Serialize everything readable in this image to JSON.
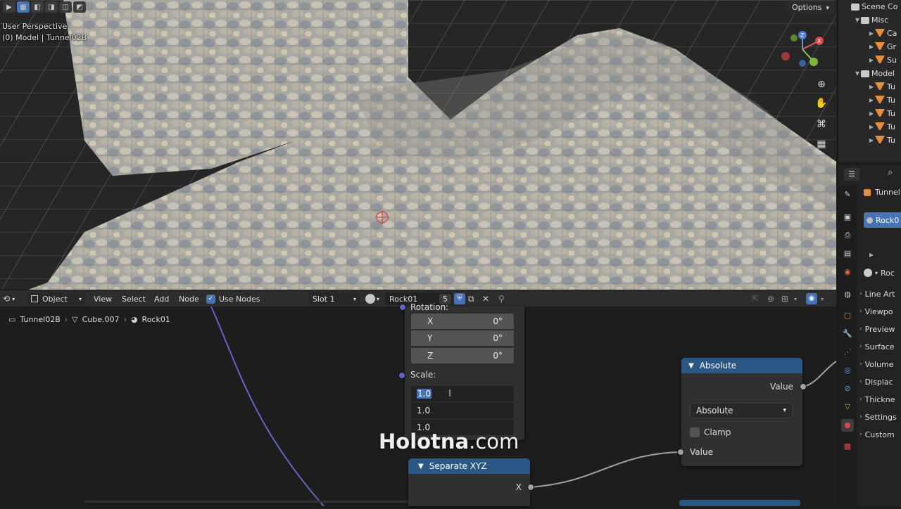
{
  "viewport": {
    "perspective_label": "User Perspective",
    "object_label": "(0) Model | Tunnel02B",
    "options_label": "Options"
  },
  "outliner": {
    "title": "Scene Co",
    "items": [
      {
        "label": "Misc",
        "type": "collection"
      },
      {
        "label": "Ca",
        "type": "object"
      },
      {
        "label": "Gr",
        "type": "object"
      },
      {
        "label": "Su",
        "type": "object"
      },
      {
        "label": "Model",
        "type": "collection"
      },
      {
        "label": "Tu",
        "type": "object"
      },
      {
        "label": "Tu",
        "type": "object"
      },
      {
        "label": "Tu",
        "type": "object"
      },
      {
        "label": "Tu",
        "type": "object"
      },
      {
        "label": "Tu",
        "type": "object"
      }
    ]
  },
  "properties": {
    "object_name": "Tunnel",
    "material_name": "Rock0",
    "material_slot": "Roc",
    "sections": [
      "Line Art",
      "Viewpo",
      "Preview",
      "Surface",
      "Volume",
      "Displac",
      "Thickne",
      "Settings",
      "Custom"
    ]
  },
  "node_header": {
    "editor_type": "Object",
    "menu": [
      "View",
      "Select",
      "Add",
      "Node"
    ],
    "use_nodes_label": "Use Nodes",
    "slot_label": "Slot 1",
    "material_name": "Rock01",
    "user_count": "5"
  },
  "breadcrumb": [
    "Tunnel02B",
    "Cube.007",
    "Rock01"
  ],
  "mapping_panel": {
    "rotation_label": "Rotation:",
    "rotation": [
      {
        "axis": "X",
        "value": "0°"
      },
      {
        "axis": "Y",
        "value": "0°"
      },
      {
        "axis": "Z",
        "value": "0°"
      }
    ],
    "scale_label": "Scale:",
    "scale": [
      "1.0",
      "1.0",
      "1.0"
    ]
  },
  "absolute_node": {
    "title": "Absolute",
    "output_label": "Value",
    "operation": "Absolute",
    "clamp_label": "Clamp",
    "input_label": "Value"
  },
  "separate_node": {
    "title": "Separate XYZ",
    "output_x": "X"
  },
  "watermark": {
    "brand": "Holotna",
    "domain": ".com"
  },
  "colors": {
    "accent": "#4772b3",
    "node_header": "#2b5785",
    "object_icon": "#e88b3a",
    "vector_socket": "#6363c7",
    "float_socket": "#a1a1a1"
  }
}
